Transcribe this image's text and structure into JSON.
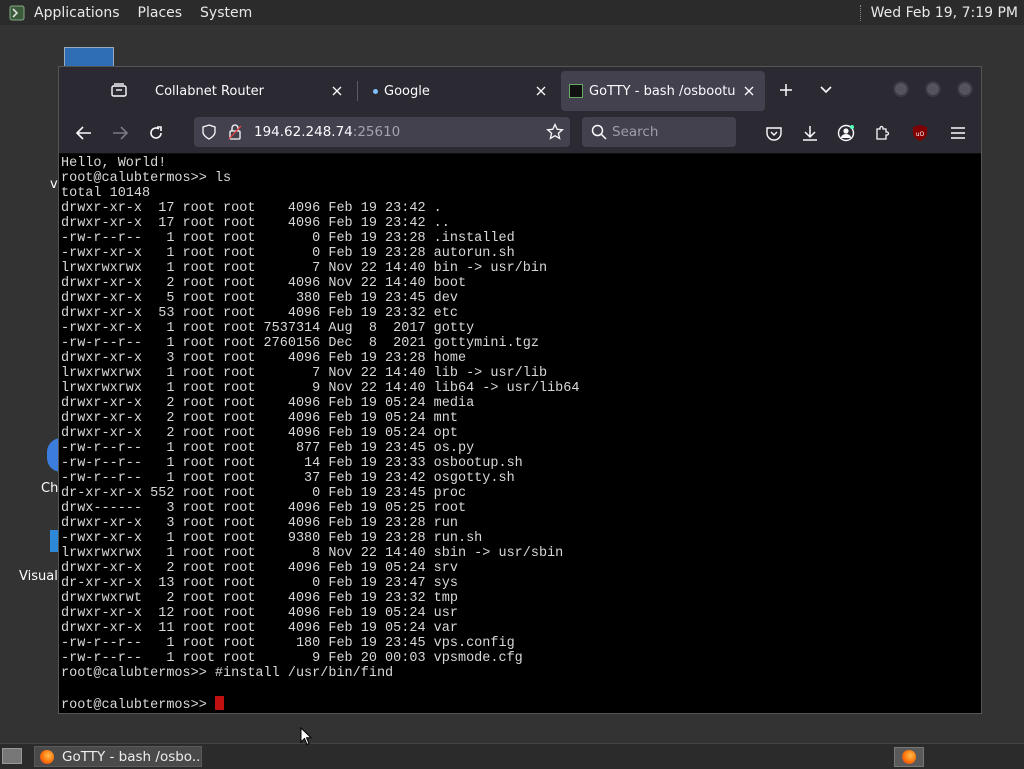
{
  "top_panel": {
    "menus": [
      "Applications",
      "Places",
      "System"
    ],
    "clock": "Wed Feb 19, 7:19 PM"
  },
  "desktop": {
    "labels": [
      "v",
      "Ch",
      "Visual"
    ]
  },
  "browser": {
    "tabs": [
      {
        "title": "Collabnet Router",
        "active": false
      },
      {
        "title": "Google",
        "active": false
      },
      {
        "title": "GoTTY - bash /osbootup.sh",
        "active": true
      }
    ],
    "url": {
      "host": "194.62.248.74",
      "port": ":25610"
    },
    "search_placeholder": "Search"
  },
  "terminal": {
    "lines": [
      "Hello, World!",
      "root@calubtermos>> ls",
      "total 10148",
      "drwxr-xr-x  17 root root    4096 Feb 19 23:42 .",
      "drwxr-xr-x  17 root root    4096 Feb 19 23:42 ..",
      "-rw-r--r--   1 root root       0 Feb 19 23:28 .installed",
      "-rwxr-xr-x   1 root root       0 Feb 19 23:28 autorun.sh",
      "lrwxrwxrwx   1 root root       7 Nov 22 14:40 bin -> usr/bin",
      "drwxr-xr-x   2 root root    4096 Nov 22 14:40 boot",
      "drwxr-xr-x   5 root root     380 Feb 19 23:45 dev",
      "drwxr-xr-x  53 root root    4096 Feb 19 23:32 etc",
      "-rwxr-xr-x   1 root root 7537314 Aug  8  2017 gotty",
      "-rw-r--r--   1 root root 2760156 Dec  8  2021 gottymini.tgz",
      "drwxr-xr-x   3 root root    4096 Feb 19 23:28 home",
      "lrwxrwxrwx   1 root root       7 Nov 22 14:40 lib -> usr/lib",
      "lrwxrwxrwx   1 root root       9 Nov 22 14:40 lib64 -> usr/lib64",
      "drwxr-xr-x   2 root root    4096 Feb 19 05:24 media",
      "drwxr-xr-x   2 root root    4096 Feb 19 05:24 mnt",
      "drwxr-xr-x   2 root root    4096 Feb 19 05:24 opt",
      "-rw-r--r--   1 root root     877 Feb 19 23:45 os.py",
      "-rw-r--r--   1 root root      14 Feb 19 23:33 osbootup.sh",
      "-rw-r--r--   1 root root      37 Feb 19 23:42 osgotty.sh",
      "dr-xr-xr-x 552 root root       0 Feb 19 23:45 proc",
      "drwx------   3 root root    4096 Feb 19 05:25 root",
      "drwxr-xr-x   3 root root    4096 Feb 19 23:28 run",
      "-rwxr-xr-x   1 root root    9380 Feb 19 23:28 run.sh",
      "lrwxrwxrwx   1 root root       8 Nov 22 14:40 sbin -> usr/sbin",
      "drwxr-xr-x   2 root root    4096 Feb 19 05:24 srv",
      "dr-xr-xr-x  13 root root       0 Feb 19 23:47 sys",
      "drwxrwxrwt   2 root root    4096 Feb 19 23:32 tmp",
      "drwxr-xr-x  12 root root    4096 Feb 19 05:24 usr",
      "drwxr-xr-x  11 root root    4096 Feb 19 05:24 var",
      "-rw-r--r--   1 root root     180 Feb 19 23:45 vps.config",
      "-rw-r--r--   1 root root       9 Feb 20 00:03 vpsmode.cfg",
      "root@calubtermos>> #install /usr/bin/find",
      ""
    ],
    "prompt": "root@calubtermos>> "
  },
  "taskbar": {
    "task_title": "GoTTY - bash /osbo..."
  }
}
